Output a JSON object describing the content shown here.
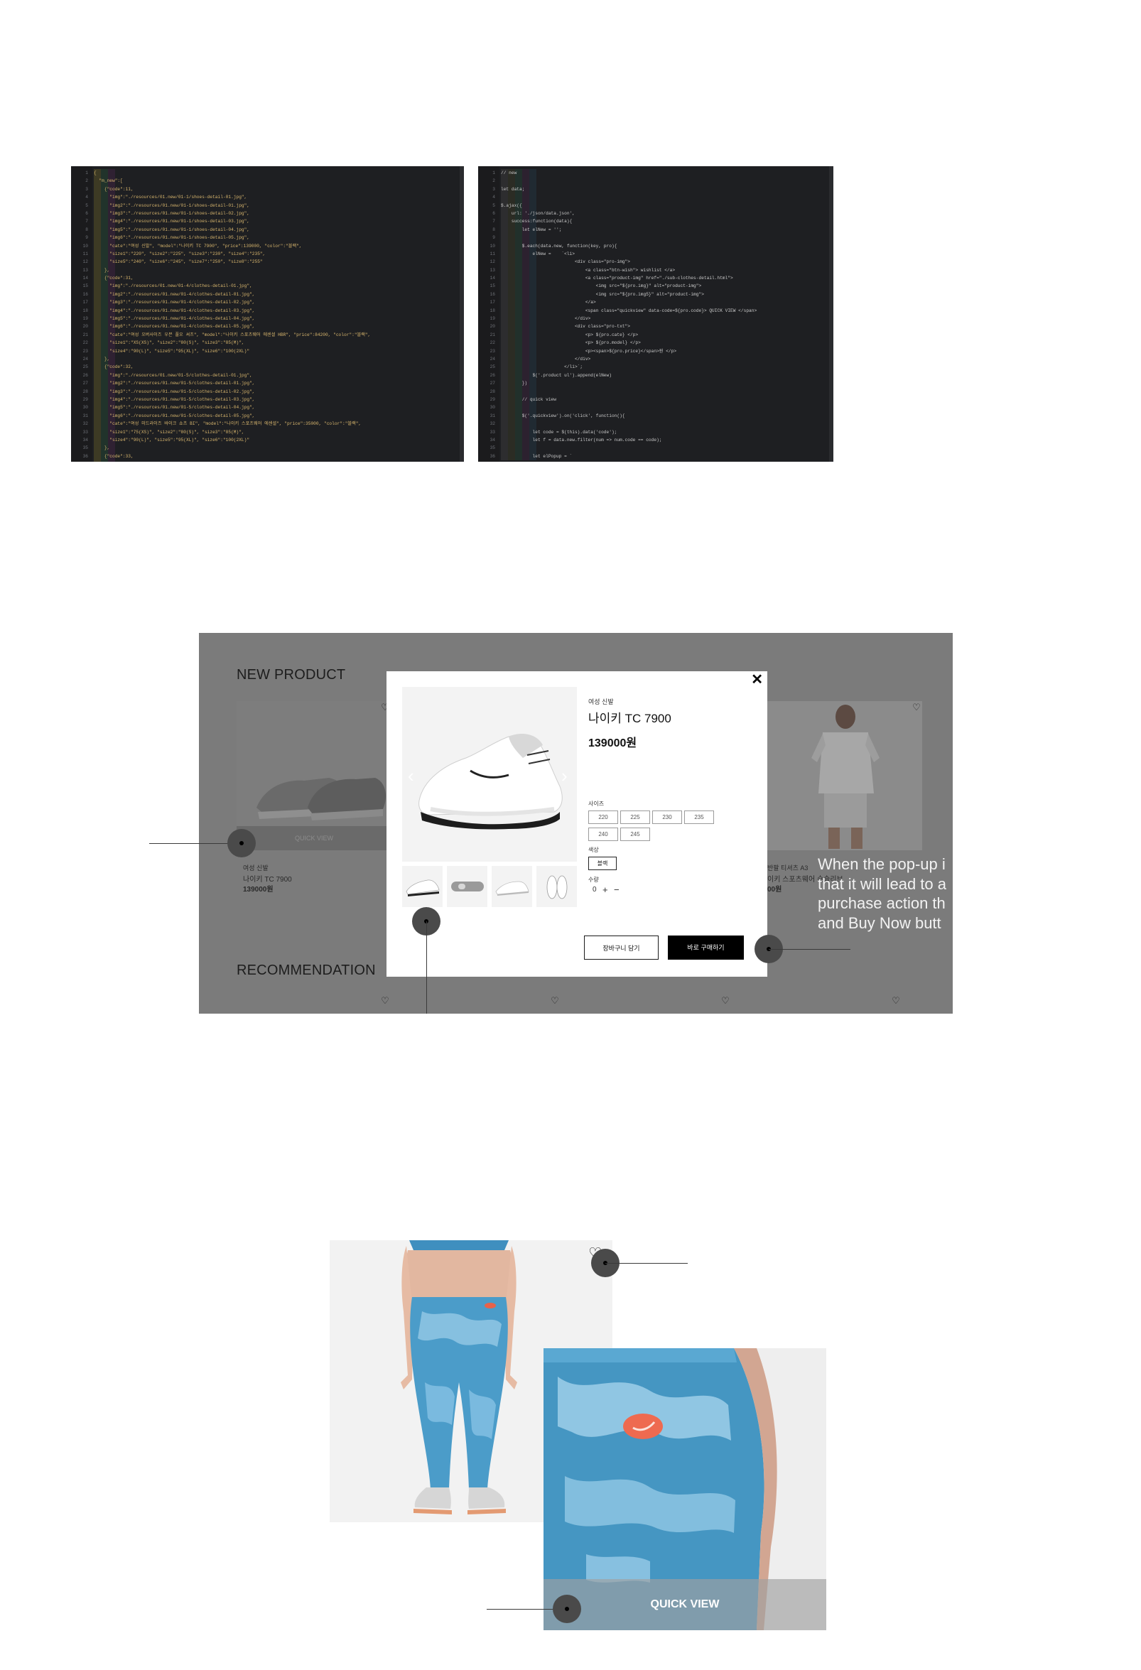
{
  "code_left": {
    "lines": [
      "{",
      "  \"m_new\":[",
      "    {\"code\":11,",
      "      \"img\":\"./resources/01.new/01-1/shoes-detail-01.jpg\",",
      "      \"img2\":\"./resources/01.new/01-1/shoes-detail-01.jpg\",",
      "      \"img3\":\"./resources/01.new/01-1/shoes-detail-02.jpg\",",
      "      \"img4\":\"./resources/01.new/01-1/shoes-detail-03.jpg\",",
      "      \"img5\":\"./resources/01.new/01-1/shoes-detail-04.jpg\",",
      "      \"img6\":\"./resources/01.new/01-1/shoes-detail-05.jpg\",",
      "      \"cate\":\"여성 신발\", \"model\":\"나이키 TC 7900\", \"price\":139000, \"color\":\"블랙\",",
      "      \"size1\":\"220\", \"size2\":\"225\", \"size3\":\"230\", \"size4\":\"235\",",
      "      \"size5\":\"240\", \"size6\":\"245\", \"size7\":\"250\", \"size8\":\"255\"",
      "    },",
      "    {\"code\":31,",
      "      \"img\":\"./resources/01.new/01-4/clothes-detail-01.jpg\",",
      "      \"img2\":\"./resources/01.new/01-4/clothes-detail-01.jpg\",",
      "      \"img3\":\"./resources/01.new/01-4/clothes-detail-02.jpg\",",
      "      \"img4\":\"./resources/01.new/01-4/clothes-detail-03.jpg\",",
      "      \"img5\":\"./resources/01.new/01-4/clothes-detail-04.jpg\",",
      "      \"img6\":\"./resources/01.new/01-4/clothes-detail-05.jpg\",",
      "      \"cate\":\"여성 오버사이즈 우븐 풀오 셔츠\", \"model\":\"나이키 스포츠웨어 에센셜 HBR\", \"price\":84200, \"color\":\"블랙\",",
      "      \"size1\":\"XS(XS)\", \"size2\":\"80(S)\", \"size3\":\"85(M)\",",
      "      \"size4\":\"90(L)\", \"size5\":\"95(XL)\", \"size6\":\"100(2XL)\"",
      "    },",
      "    {\"code\":32,",
      "      \"img\":\"./resources/01.new/01-5/clothes-detail-01.jpg\",",
      "      \"img2\":\"./resources/01.new/01-5/clothes-detail-01.jpg\",",
      "      \"img3\":\"./resources/01.new/01-5/clothes-detail-02.jpg\",",
      "      \"img4\":\"./resources/01.new/01-5/clothes-detail-03.jpg\",",
      "      \"img5\":\"./resources/01.new/01-5/clothes-detail-04.jpg\",",
      "      \"img6\":\"./resources/01.new/01-5/clothes-detail-05.jpg\",",
      "      \"cate\":\"여성 미드라이즈 바이크 쇼츠 BI\", \"model\":\"나이키 스포츠웨어 에센셜\", \"price\":35000, \"color\":\"블랙\",",
      "      \"size1\":\"75(XS)\", \"size2\":\"80(S)\", \"size3\":\"85(M)\",",
      "      \"size4\":\"90(L)\", \"size5\":\"95(XL)\", \"size6\":\"100(2XL)\"",
      "    },",
      "    {\"code\":33,",
      "      \"img\":\"./resources/01.new/01-6/clothes-detail-01.jpg\",",
      "      \"img2\":\"./resources/01.new/01-6/clothes-detail-01.jpg\",",
      "      \"img3\":\"./resources/01.new/01-6/clothes-detail-02.jpg\",",
      "      \"img4\":\"./resources/01.new/01-6/clothes-detail-03.jpg\","
    ]
  },
  "code_right": {
    "lines": [
      "// new",
      "",
      "let data;",
      "",
      "$.ajax({",
      "    url: './json/data.json',",
      "    success:function(data){",
      "        let elNew = '';",
      "",
      "        $.each(data.new, function(key, pro){",
      "            elNew =    `<li>",
      "                            <div class=\"pro-img\">",
      "                                <a class=\"btn-wish\"> wishlist </a>",
      "                                <a class=\"product-img\" href=\"./sub-clothes-detail.html\">",
      "                                    <img src=\"${pro.img}\" alt=\"product-img\">",
      "                                    <img src=\"${pro.img5}\" alt=\"product-img\">",
      "                                </a>",
      "                                <span class=\"quickview\" data-code=${pro.code}> QUICK VIEW </span>",
      "                            </div>",
      "                            <div class=\"pro-txt\">",
      "                                <p> ${pro.cate} </p>",
      "                                <p> ${pro.model} </p>",
      "                                <p><span>${pro.price}</span>원 </p>",
      "                            </div>",
      "                        </li>`;",
      "            $('.product ul').append(elNew)",
      "        })",
      "",
      "        // quick view",
      "",
      "        $('.quickview').on('click', function(){",
      "",
      "            let code = $(this).data('code');",
      "            let f = data.new.filter(num => num.code == code);",
      "",
      "            let elPopup = `"
    ]
  },
  "mockup": {
    "section_new": "NEW PRODUCT",
    "section_reco": "RECOMMENDATION",
    "left_card": {
      "quick_view": "QUICK VIEW",
      "category": "여성 신발",
      "model": "나이키 TC 7900",
      "price": "139000원"
    },
    "right_card": {
      "category": "반팔 티셔츠 A3",
      "model": "이키 스포츠웨어 숏슬리브",
      "price": "00원"
    },
    "popup": {
      "close": "✕",
      "category": "여성 신발",
      "model": "나이키 TC 7900",
      "price": "139000원",
      "size_label": "사이즈",
      "sizes": [
        "220",
        "225",
        "230",
        "235",
        "240",
        "245"
      ],
      "color_label": "색상",
      "color_value": "블랙",
      "qty_label": "수량",
      "qty_value": "0",
      "qty_plus": "+",
      "qty_minus": "−",
      "cart_button": "장바구니 담기",
      "buy_button": "바로 구매하기"
    },
    "annotation_text": [
      "When the pop-up i",
      "that it will lead to a",
      "purchase action th",
      "and Buy Now butt"
    ]
  },
  "leggings": {
    "quick_view": "QUICK VIEW",
    "heart_icon": "heart-icon"
  }
}
